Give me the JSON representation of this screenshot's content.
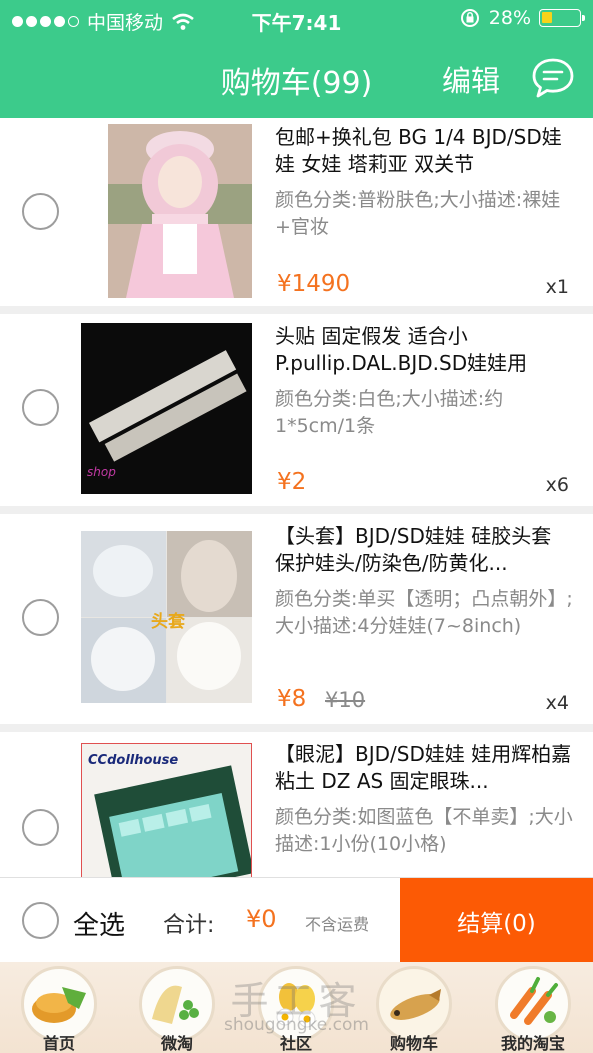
{
  "status_bar": {
    "carrier": "中国移动",
    "time": "下午7:41",
    "battery": "28%"
  },
  "header": {
    "title": "购物车(99)",
    "edit": "编辑",
    "message_icon": "chat-bubble-icon"
  },
  "items": [
    {
      "title": "包邮+换礼包 BG 1/4 BJD/SD娃娃 女娃 塔莉亚 双关节",
      "spec": "颜色分类:普粉肤色;大小描述:裸娃+官妆",
      "price": "¥1490",
      "qty": "x1"
    },
    {
      "title": "头贴 固定假发 适合小P.pullip.DAL.BJD.SD娃娃用",
      "spec": "颜色分类:白色;大小描述:约1*5cm/1条",
      "price": "¥2",
      "qty": "x6",
      "image_text": "shop"
    },
    {
      "title": "【头套】BJD/SD娃娃 硅胶头套 保护娃头/防染色/防黄化...",
      "spec": "颜色分类:单买【透明；凸点朝外】;大小描述:4分娃娃(7~8inch)",
      "price": "¥8",
      "old_price": "¥10",
      "qty": "x4",
      "image_text": "头套"
    },
    {
      "title": "【眼泥】BJD/SD娃娃 娃用辉柏嘉粘土 DZ AS 固定眼珠...",
      "spec": "颜色分类:如图蓝色【不单卖】;大小描述:1小份(10小格)",
      "image_text": "CCdollhouse"
    }
  ],
  "bottom_bar": {
    "select_all": "全选",
    "total_label": "合计:",
    "total_value": "¥0",
    "shipping_note": "不含运费",
    "checkout": "结算(0)"
  },
  "tabs": [
    {
      "label": "首页",
      "icon": "home-dish-icon"
    },
    {
      "label": "微淘",
      "icon": "weitao-dish-icon"
    },
    {
      "label": "社区",
      "icon": "community-dish-icon"
    },
    {
      "label": "购物车",
      "icon": "cart-dish-icon"
    },
    {
      "label": "我的淘宝",
      "icon": "my-taobao-dish-icon"
    }
  ],
  "watermark": {
    "main": "手工客",
    "sub": "shougongke.com"
  },
  "colors": {
    "header": "#3ccb8b",
    "price": "#f4721f",
    "checkout": "#fc5a05"
  }
}
